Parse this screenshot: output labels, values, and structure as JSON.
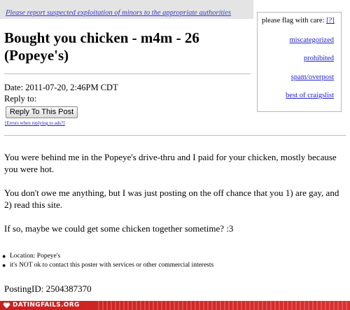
{
  "banner": {
    "warning_text": "Please report suspected exploitation of minors to the appropriate authorities"
  },
  "flag_box": {
    "title": "please flag with care:",
    "help_link": "[?]",
    "links": [
      "miscategorized",
      "prohibited",
      "spam/overpost",
      "best of craigslist"
    ]
  },
  "post": {
    "title": "Bought you chicken - m4m - 26 (Popeye's)",
    "date": "Date: 2011-07-20, 2:46PM CDT",
    "reply_to": "Reply to:",
    "reply_button": "Reply To This Post",
    "errors_link": "[Errors when replying to ads?]",
    "paragraphs": [
      "You were behind me in the Popeye's drive-thru and I paid for your chicken, mostly because you were hot.",
      "You don't owe me anything, but I was just posting on the off chance that you 1) are gay, and 2) read this site.",
      "If so, maybe we could get some chicken together sometime? :3"
    ],
    "notices": [
      "Location: Popeye's",
      "it's NOT ok to contact this poster with services or other commercial interests"
    ],
    "posting_id": "PostingID: 2504387370"
  },
  "watermark": {
    "text": "DATINGFAILS.ORG",
    "bar_color": "#c9211e"
  },
  "icons": {
    "watermark_logo": "heart-icon",
    "bullet": "bullet-icon"
  }
}
